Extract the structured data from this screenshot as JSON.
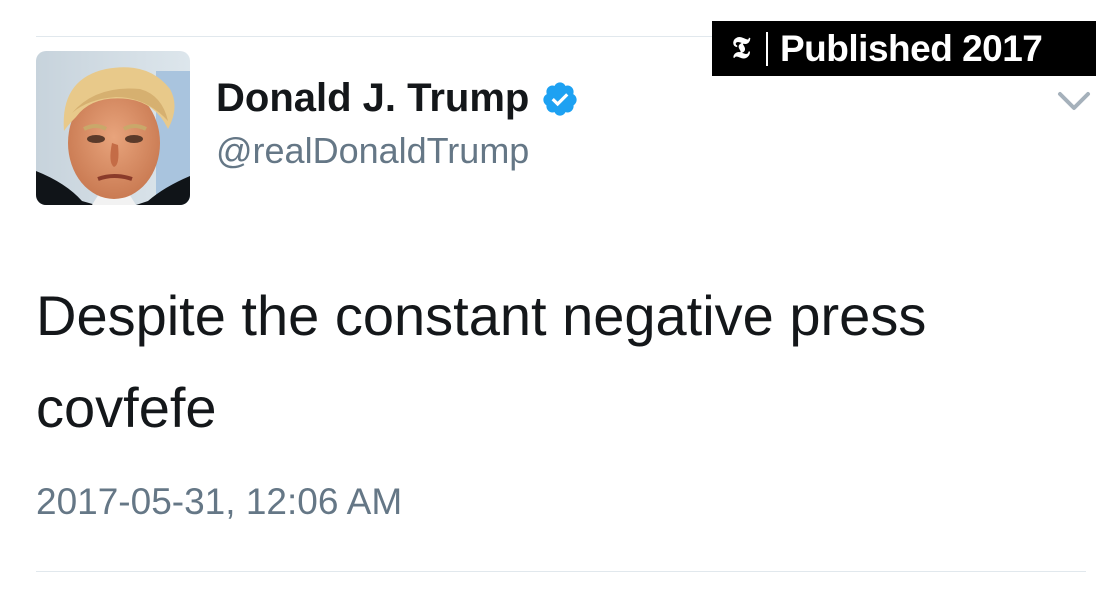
{
  "badge": {
    "logo_glyph": "𝕿",
    "text": "Published 2017"
  },
  "tweet": {
    "display_name": "Donald J. Trump",
    "handle": "@realDonaldTrump",
    "verified": true,
    "text_lines": [
      "Despite the constant negative press",
      "covfefe"
    ],
    "timestamp": "2017-05-31, 12:06 AM"
  },
  "icons": {
    "verified": "verified-badge-icon",
    "menu": "chevron-down-icon",
    "nyt_logo": "nyt-t-logo"
  },
  "colors": {
    "verified_blue": "#1da1f2",
    "text_primary": "#14171a",
    "text_secondary": "#657786",
    "divider": "#e1e8ed",
    "badge_background": "#000000"
  }
}
